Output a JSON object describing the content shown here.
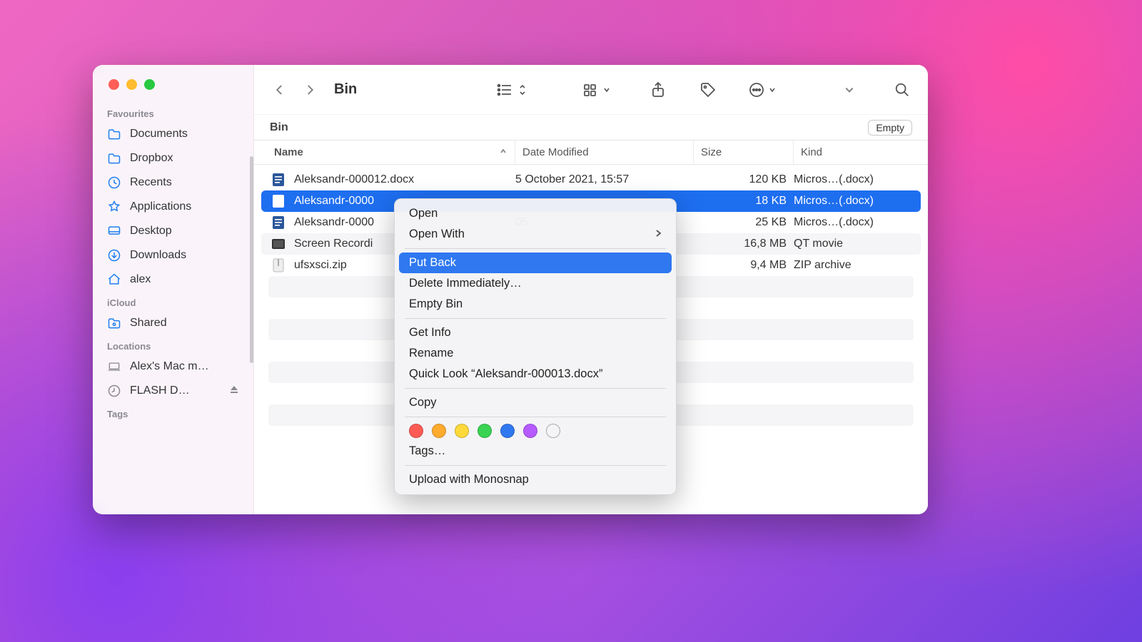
{
  "window": {
    "title": "Bin"
  },
  "toolbar": {
    "empty_label": "Empty"
  },
  "sidebar": {
    "sections": [
      {
        "header": "Favourites",
        "items": [
          {
            "label": "Documents",
            "icon": "folder"
          },
          {
            "label": "Dropbox",
            "icon": "folder"
          },
          {
            "label": "Recents",
            "icon": "clock"
          },
          {
            "label": "Applications",
            "icon": "appstore"
          },
          {
            "label": "Desktop",
            "icon": "desktop"
          },
          {
            "label": "Downloads",
            "icon": "download"
          },
          {
            "label": "alex",
            "icon": "home"
          }
        ]
      },
      {
        "header": "iCloud",
        "items": [
          {
            "label": "Shared",
            "icon": "shared"
          }
        ]
      },
      {
        "header": "Locations",
        "items": [
          {
            "label": "Alex's Mac m…",
            "icon": "laptop",
            "gray": true
          },
          {
            "label": "FLASH D…",
            "icon": "disk",
            "gray": true,
            "eject": true
          }
        ]
      },
      {
        "header": "Tags",
        "items": []
      }
    ]
  },
  "path": {
    "location": "Bin"
  },
  "columns": {
    "name": "Name",
    "date": "Date Modified",
    "size": "Size",
    "kind": "Kind"
  },
  "rows": [
    {
      "name": "Aleksandr-000012.docx",
      "date": "5 October 2021, 15:57",
      "size": "120 KB",
      "kind": "Micros…(.docx)",
      "type": "docx"
    },
    {
      "name": "Aleksandr-0000",
      "date": "",
      "size": "18 KB",
      "kind": "Micros…(.docx)",
      "type": "docx",
      "selected": true
    },
    {
      "name": "Aleksandr-0000",
      "date": "05",
      "size": "25 KB",
      "kind": "Micros…(.docx)",
      "type": "docx"
    },
    {
      "name": "Screen Recordi",
      "date": "",
      "size": "16,8 MB",
      "kind": "QT movie",
      "type": "mov"
    },
    {
      "name": "ufsxsci.zip",
      "date": "",
      "size": "9,4 MB",
      "kind": "ZIP archive",
      "type": "zip"
    }
  ],
  "context_menu": {
    "target_file": "Aleksandr-000013.docx",
    "items": {
      "open": "Open",
      "open_with": "Open With",
      "put_back": "Put Back",
      "delete": "Delete Immediately…",
      "empty": "Empty Bin",
      "get_info": "Get Info",
      "rename": "Rename",
      "quick_look": "Quick Look “Aleksandr-000013.docx”",
      "copy": "Copy",
      "tags": "Tags…",
      "upload": "Upload with Monosnap"
    },
    "tag_colors": [
      "#ff5b55",
      "#ffab2e",
      "#ffd93a",
      "#39d353",
      "#2f78f0",
      "#b65bff",
      "transparent"
    ]
  }
}
